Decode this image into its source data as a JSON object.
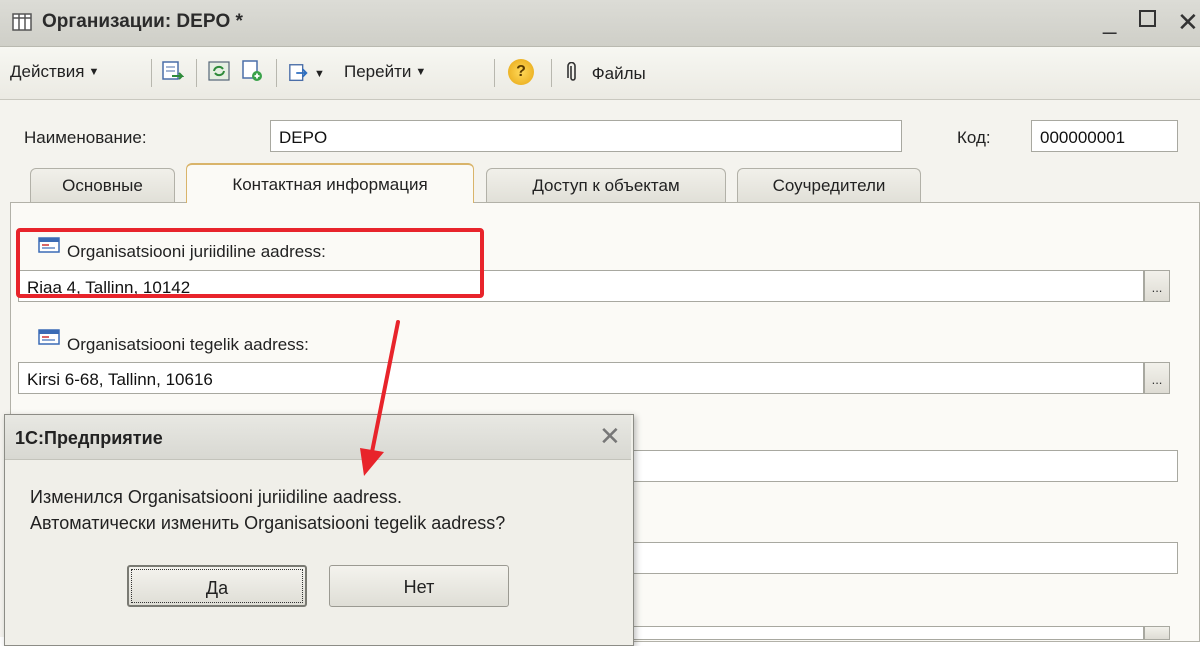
{
  "window": {
    "title": "Организации: DEPO *"
  },
  "toolbar": {
    "actions_label": "Действия",
    "goto_label": "Перейти",
    "files_label": "Файлы",
    "help_label": "?"
  },
  "form": {
    "name_label": "Наименование:",
    "name_value": "DEPO",
    "code_label": "Код:",
    "code_value": "000000001"
  },
  "tabs": [
    {
      "label": "Основные"
    },
    {
      "label": "Контактная информация"
    },
    {
      "label": "Доступ к объектам"
    },
    {
      "label": "Соучредители"
    }
  ],
  "contact": {
    "legal_label": "Organisatsiooni juriidiline aadress:",
    "legal_value": "Riaa 4, Tallinn, 10142",
    "actual_label": "Organisatsiooni tegelik aadress:",
    "actual_value": "Kirsi 6-68, Tallinn, 10616",
    "ellipsis": "..."
  },
  "dialog": {
    "title": "1С:Предприятие",
    "message_line1": "Изменился Organisatsiooni juriidiline aadress.",
    "message_line2": "Автоматически изменить Organisatsiooni tegelik aadress?",
    "yes_label": "Да",
    "no_label": "Нет"
  },
  "colors": {
    "highlight": "#e8242b",
    "active_tab_border": "#d9b46a"
  }
}
